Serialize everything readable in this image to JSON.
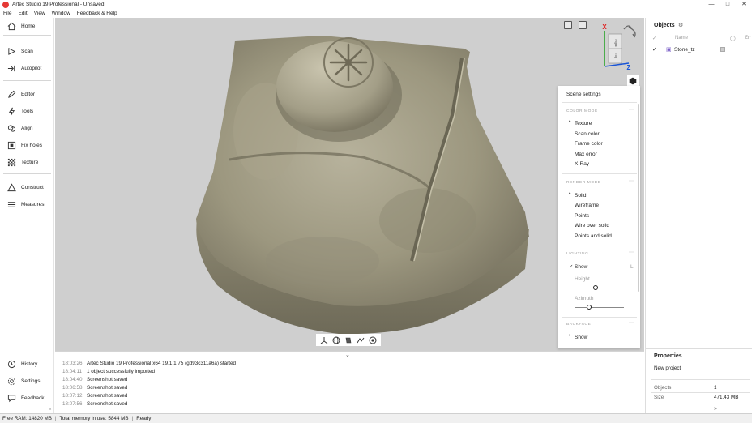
{
  "window": {
    "title": "Artec Studio 19 Professional - Unsaved"
  },
  "menu": [
    "File",
    "Edit",
    "View",
    "Window",
    "Feedback & Help"
  ],
  "sidebar": {
    "items": [
      {
        "label": "Home",
        "icon": "home-icon"
      },
      {
        "label": "Scan",
        "icon": "scan-icon"
      },
      {
        "label": "Autopilot",
        "icon": "autopilot-icon"
      },
      {
        "label": "Editor",
        "icon": "editor-icon"
      },
      {
        "label": "Tools",
        "icon": "tools-icon"
      },
      {
        "label": "Align",
        "icon": "align-icon"
      },
      {
        "label": "Fix holes",
        "icon": "fix-holes-icon"
      },
      {
        "label": "Texture",
        "icon": "texture-icon"
      },
      {
        "label": "Construct",
        "icon": "construct-icon"
      },
      {
        "label": "Measures",
        "icon": "measures-icon"
      }
    ],
    "bottom_items": [
      {
        "label": "History",
        "icon": "history-icon"
      },
      {
        "label": "Settings",
        "icon": "settings-icon"
      },
      {
        "label": "Feedback",
        "icon": "feedback-icon"
      }
    ]
  },
  "gizmo": {
    "x_label": "X",
    "z_label": "Z",
    "cube_right": "Right",
    "cube_top": "Top"
  },
  "scene_settings": {
    "title": "Scene settings",
    "color_mode": {
      "heading": "COLOR MODE",
      "options": [
        "Texture",
        "Scan color",
        "Frame color",
        "Max error",
        "X-Ray"
      ],
      "selected": "Texture"
    },
    "render_mode": {
      "heading": "RENDER MODE",
      "options": [
        "Solid",
        "Wireframe",
        "Points",
        "Wire over solid",
        "Points and solid"
      ],
      "selected": "Solid"
    },
    "lighting": {
      "heading": "LIGHTING",
      "show_label": "Show",
      "show_checked": true,
      "shortcut": "L",
      "height_label": "Height",
      "height_value": 0.42,
      "azimuth_label": "Azimuth",
      "azimuth_value": 0.3
    },
    "backface": {
      "heading": "BACKFACE",
      "show_label": "Show"
    }
  },
  "log": [
    {
      "time": "18:03:26",
      "message": "Artec Studio 19 Professional x64 19.1.1.75 (gd93c311a6a) started"
    },
    {
      "time": "18:04:11",
      "message": "1 object successfully imported"
    },
    {
      "time": "18:04:40",
      "message": "Screenshot saved"
    },
    {
      "time": "18:06:58",
      "message": "Screenshot saved"
    },
    {
      "time": "18:07:12",
      "message": "Screenshot saved"
    },
    {
      "time": "18:07:56",
      "message": "Screenshot saved"
    }
  ],
  "objects": {
    "title": "Objects",
    "col_name": "Name",
    "col_err": "Err",
    "items": [
      {
        "name": "Stone_tz",
        "checked": true
      }
    ]
  },
  "properties": {
    "title": "Properties",
    "project": "New project",
    "rows": [
      {
        "key": "Objects",
        "value": "1"
      },
      {
        "key": "Size",
        "value": "471.43 MB"
      }
    ]
  },
  "status": {
    "free_ram": "Free RAM: 14820 MB",
    "total_memory": "Total memory in use: 5844 MB",
    "state": "Ready"
  },
  "colors": {
    "accent": "#1a55d6",
    "axis_x": "#e02020",
    "axis_y": "#1fa01f",
    "axis_z": "#1a55d6",
    "viewport_bg": "#cfcfcf"
  }
}
